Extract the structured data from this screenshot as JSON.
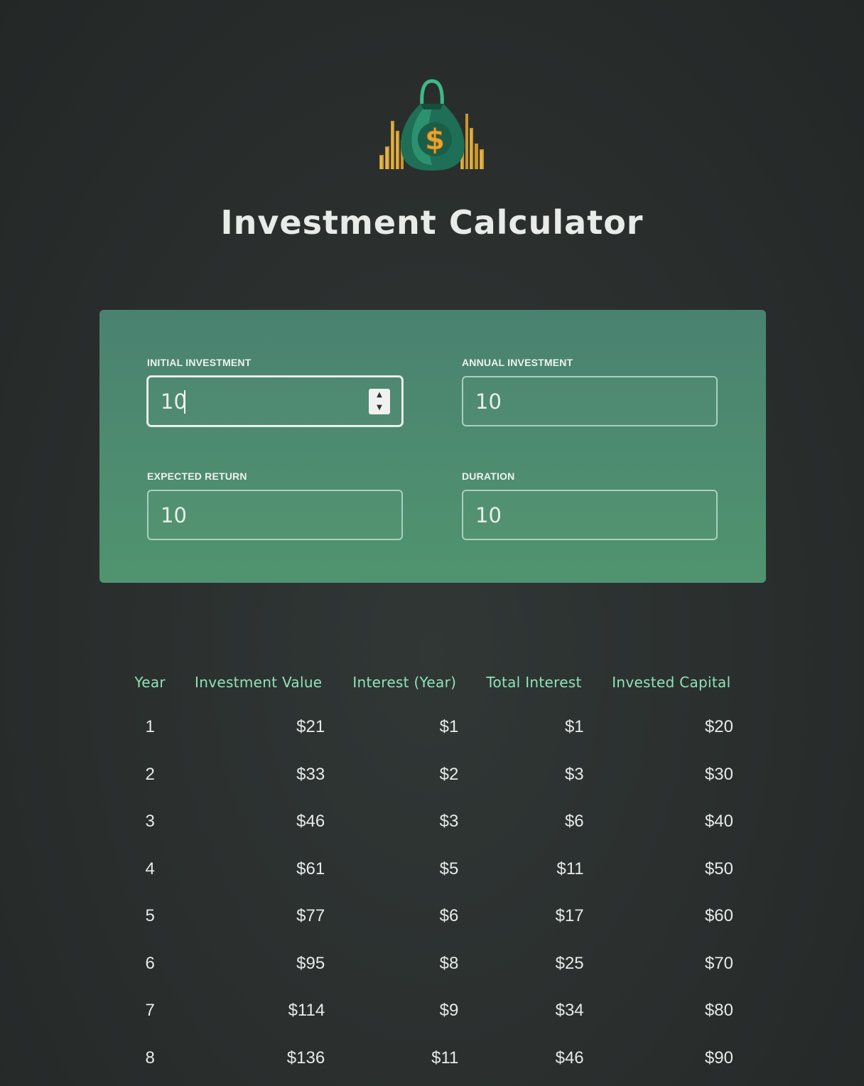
{
  "header": {
    "title": "Investment Calculator",
    "logo_icon": "money-bag-icon"
  },
  "inputs": [
    {
      "label": "INITIAL INVESTMENT",
      "value": "10",
      "focused": true
    },
    {
      "label": "ANNUAL INVESTMENT",
      "value": "10",
      "focused": false
    },
    {
      "label": "EXPECTED RETURN",
      "value": "10",
      "focused": false
    },
    {
      "label": "DURATION",
      "value": "10",
      "focused": false
    }
  ],
  "table": {
    "headers": [
      "Year",
      "Investment Value",
      "Interest (Year)",
      "Total Interest",
      "Invested Capital"
    ],
    "rows": [
      [
        "1",
        "$21",
        "$1",
        "$1",
        "$20"
      ],
      [
        "2",
        "$33",
        "$2",
        "$3",
        "$30"
      ],
      [
        "3",
        "$46",
        "$3",
        "$6",
        "$40"
      ],
      [
        "4",
        "$61",
        "$5",
        "$11",
        "$50"
      ],
      [
        "5",
        "$77",
        "$6",
        "$17",
        "$60"
      ],
      [
        "6",
        "$95",
        "$8",
        "$25",
        "$70"
      ],
      [
        "7",
        "$114",
        "$9",
        "$34",
        "$80"
      ],
      [
        "8",
        "$136",
        "$11",
        "$46",
        "$90"
      ]
    ]
  },
  "colors": {
    "accent": "#8ee3b8",
    "panel": "#4a8270",
    "background": "#2b302f"
  }
}
